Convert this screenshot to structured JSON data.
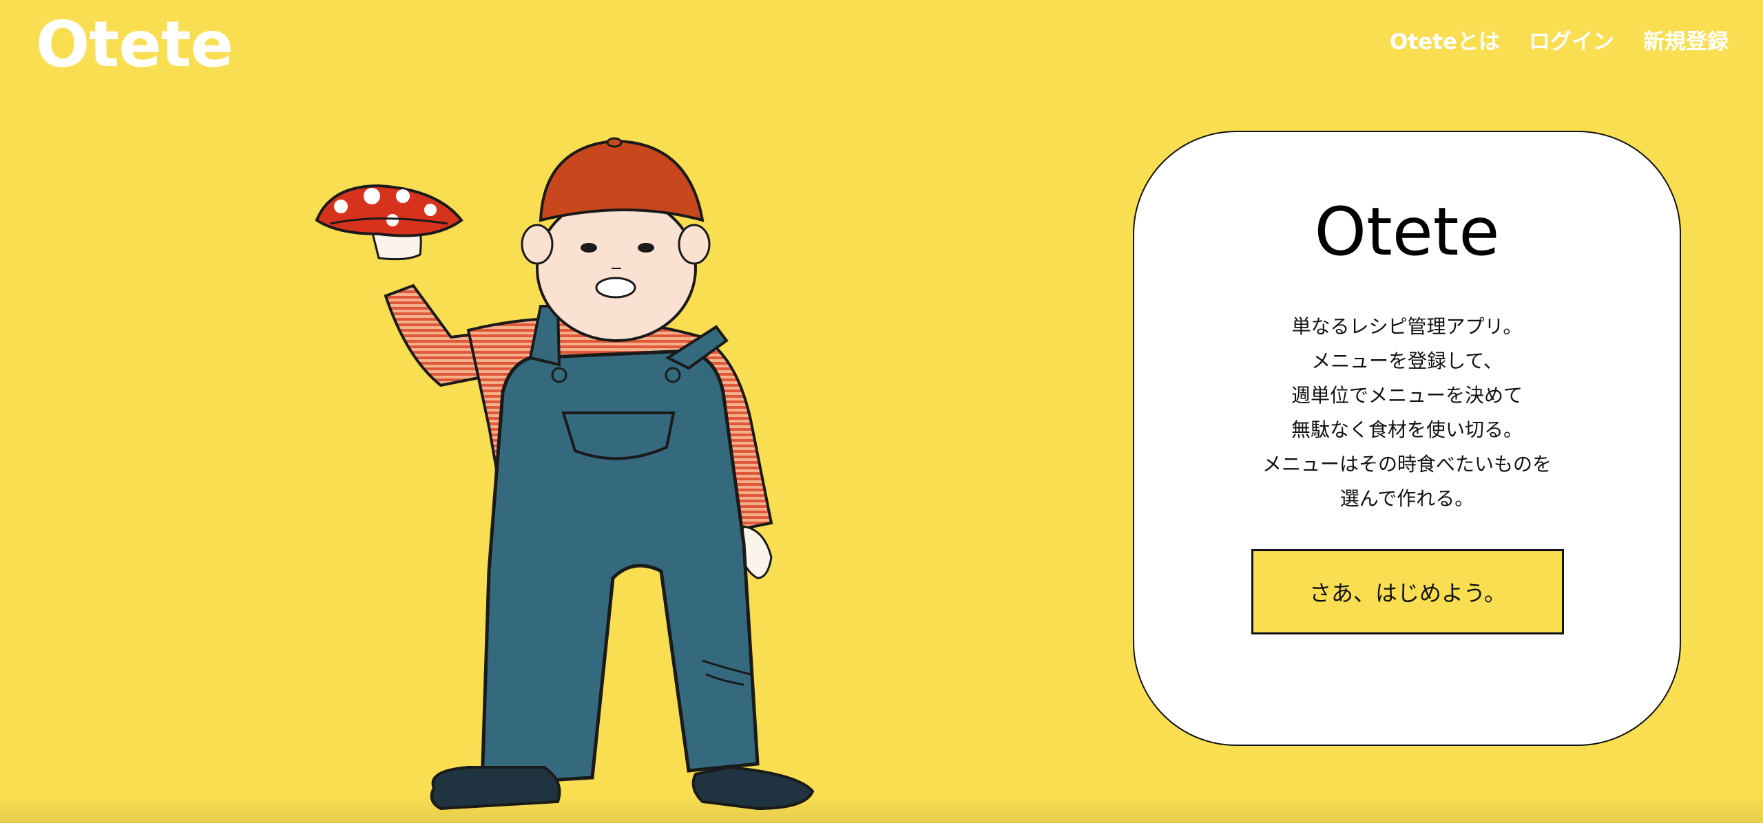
{
  "header": {
    "logo": "Otete",
    "nav": {
      "about": "Oteteとは",
      "login": "ログイン",
      "signup": "新規登録"
    }
  },
  "hero": {
    "illustration_icon": "child-holding-mushroom-illustration"
  },
  "card": {
    "title": "Otete",
    "description_lines": [
      "単なるレシピ管理アプリ。",
      "メニューを登録して、",
      "週単位でメニューを決めて",
      "無駄なく食材を使い切る。",
      "メニューはその時食べたいものを",
      "選んで作れる。"
    ],
    "cta_label": "さあ、はじめよう。"
  },
  "colors": {
    "background": "#f9de52",
    "card": "#ffffff",
    "cta": "#f9de52",
    "text": "#111111"
  }
}
